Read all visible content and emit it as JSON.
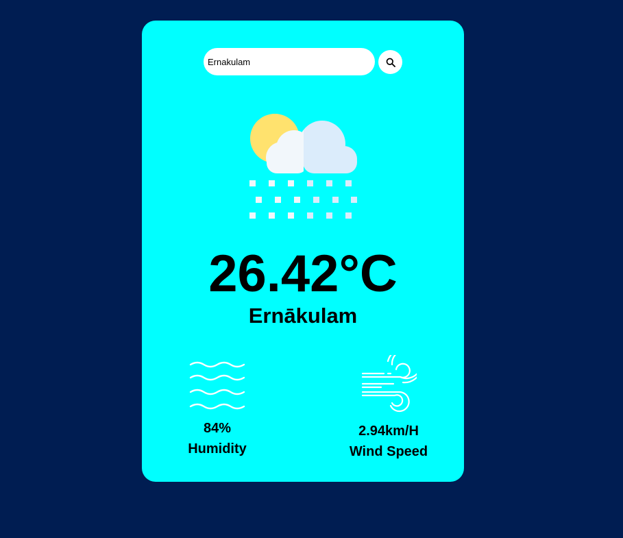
{
  "search": {
    "value": "Ernakulam",
    "button_icon": "search-icon"
  },
  "weather": {
    "icon": "sun-cloud-snow-icon",
    "temperature": "26.42°C",
    "city": "Ernākulam"
  },
  "humidity": {
    "icon": "humidity-waves-icon",
    "value": "84%",
    "label": "Humidity"
  },
  "wind": {
    "icon": "wind-icon",
    "value": "2.94km/H",
    "label": "Wind Speed"
  },
  "colors": {
    "background": "#001d52",
    "card": "#00ffff",
    "text": "#000000",
    "sun": "#ffe26e",
    "cloud_light": "#f2f7fb",
    "cloud_shade": "#dbecfb"
  }
}
